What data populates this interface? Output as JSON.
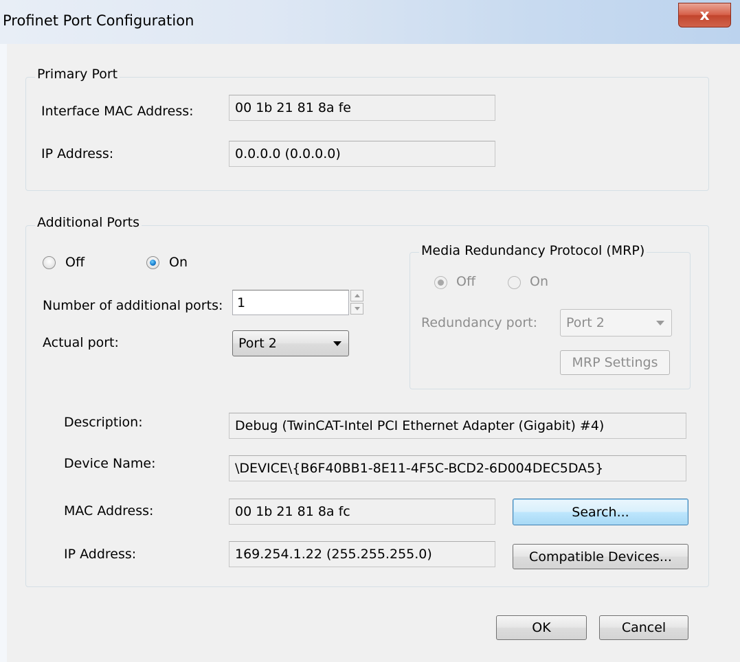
{
  "window": {
    "title": "Profinet Port Configuration",
    "close_glyph": "x"
  },
  "primary_port": {
    "legend": "Primary Port",
    "mac_label": "Interface MAC Address:",
    "mac_value": "00 1b 21 81 8a fe",
    "ip_label": "IP Address:",
    "ip_value": "0.0.0.0 (0.0.0.0)"
  },
  "additional_ports": {
    "legend": "Additional Ports",
    "radio_off_label": "Off",
    "radio_on_label": "On",
    "selected": "On",
    "number_label": "Number of additional ports:",
    "number_value": "1",
    "actual_port_label": "Actual port:",
    "actual_port_value": "Port 2"
  },
  "mrp": {
    "legend": "Media Redundancy Protocol (MRP)",
    "radio_off_label": "Off",
    "radio_on_label": "On",
    "selected": "Off",
    "redundancy_port_label": "Redundancy port:",
    "redundancy_port_value": "Port 2",
    "settings_button": "MRP Settings"
  },
  "port_details": {
    "description_label": "Description:",
    "description_value": "Debug (TwinCAT-Intel PCI Ethernet Adapter (Gigabit) #4)",
    "device_name_label": "Device Name:",
    "device_name_value": "\\DEVICE\\{B6F40BB1-8E11-4F5C-BCD2-6D004DEC5DA5}",
    "mac_label": "MAC Address:",
    "mac_value": "00 1b 21 81 8a fc",
    "ip_label": "IP Address:",
    "ip_value": "169.254.1.22 (255.255.255.0)",
    "search_button": "Search...",
    "compatible_button": "Compatible Devices..."
  },
  "footer": {
    "ok_button": "OK",
    "cancel_button": "Cancel"
  },
  "icons": {
    "close": "close-icon",
    "dropdown": "chevron-down-icon",
    "spin_up": "spin-up-icon",
    "spin_down": "spin-down-icon"
  },
  "colors": {
    "dialog_bg": "#f0f0f0",
    "close_button": "#c2452d",
    "radio_selected": "#1a7fd0",
    "focus_button": "#3c7fb1"
  }
}
